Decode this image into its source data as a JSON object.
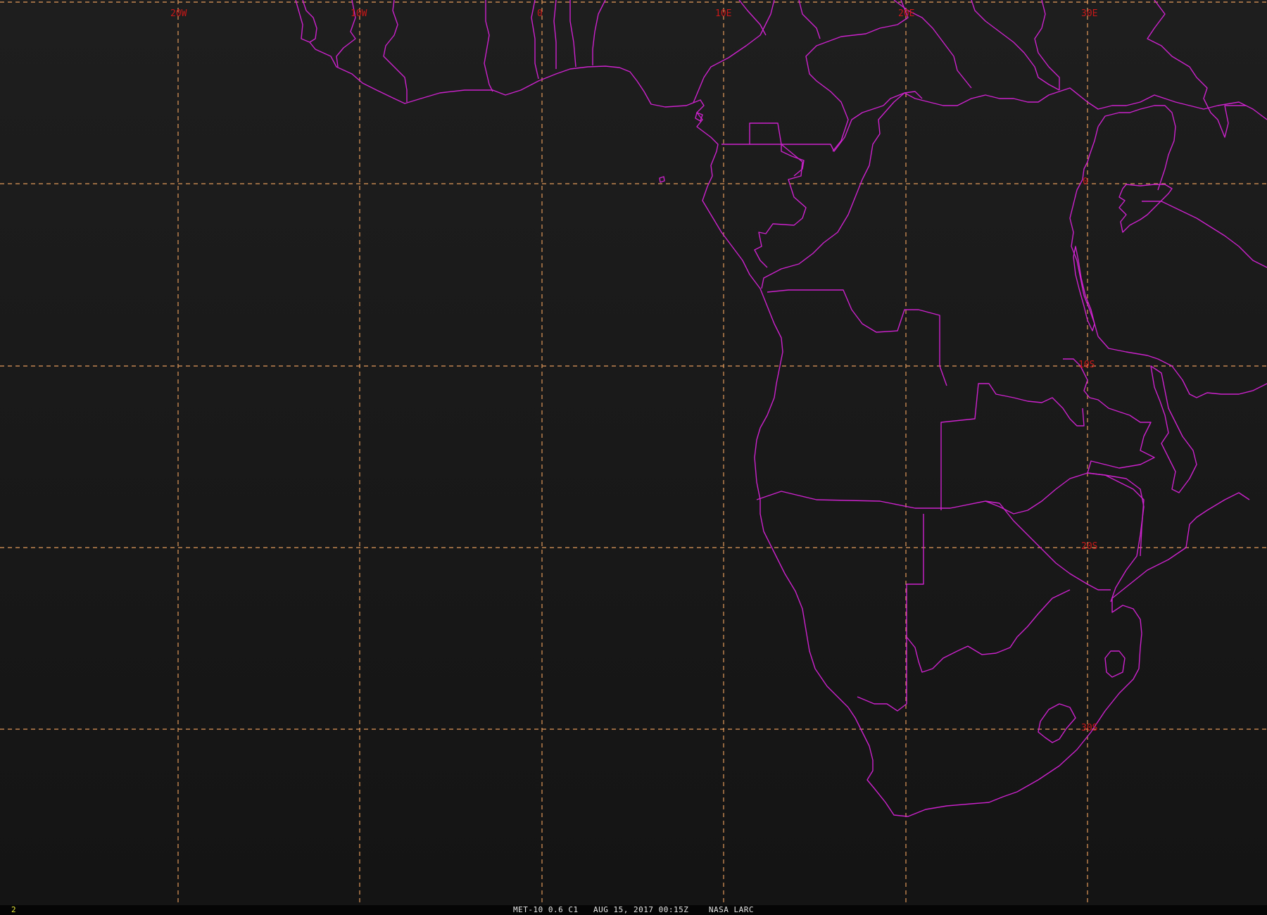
{
  "map": {
    "longitude_labels": [
      "20W",
      "10W",
      "0",
      "10E",
      "20E",
      "30E"
    ],
    "latitude_labels": [
      "0",
      "10S",
      "20S",
      "30S"
    ],
    "colors": {
      "background": "#1b1b1b",
      "gridlines": "#e39a5a",
      "boundaries": "#cc22cc",
      "labels": "#c81818"
    }
  },
  "footer": {
    "frame_number": "2",
    "satellite": "MET-10 0.6 C1",
    "datetime": "AUG 15, 2017 00:15Z",
    "source": "NASA LARC"
  }
}
